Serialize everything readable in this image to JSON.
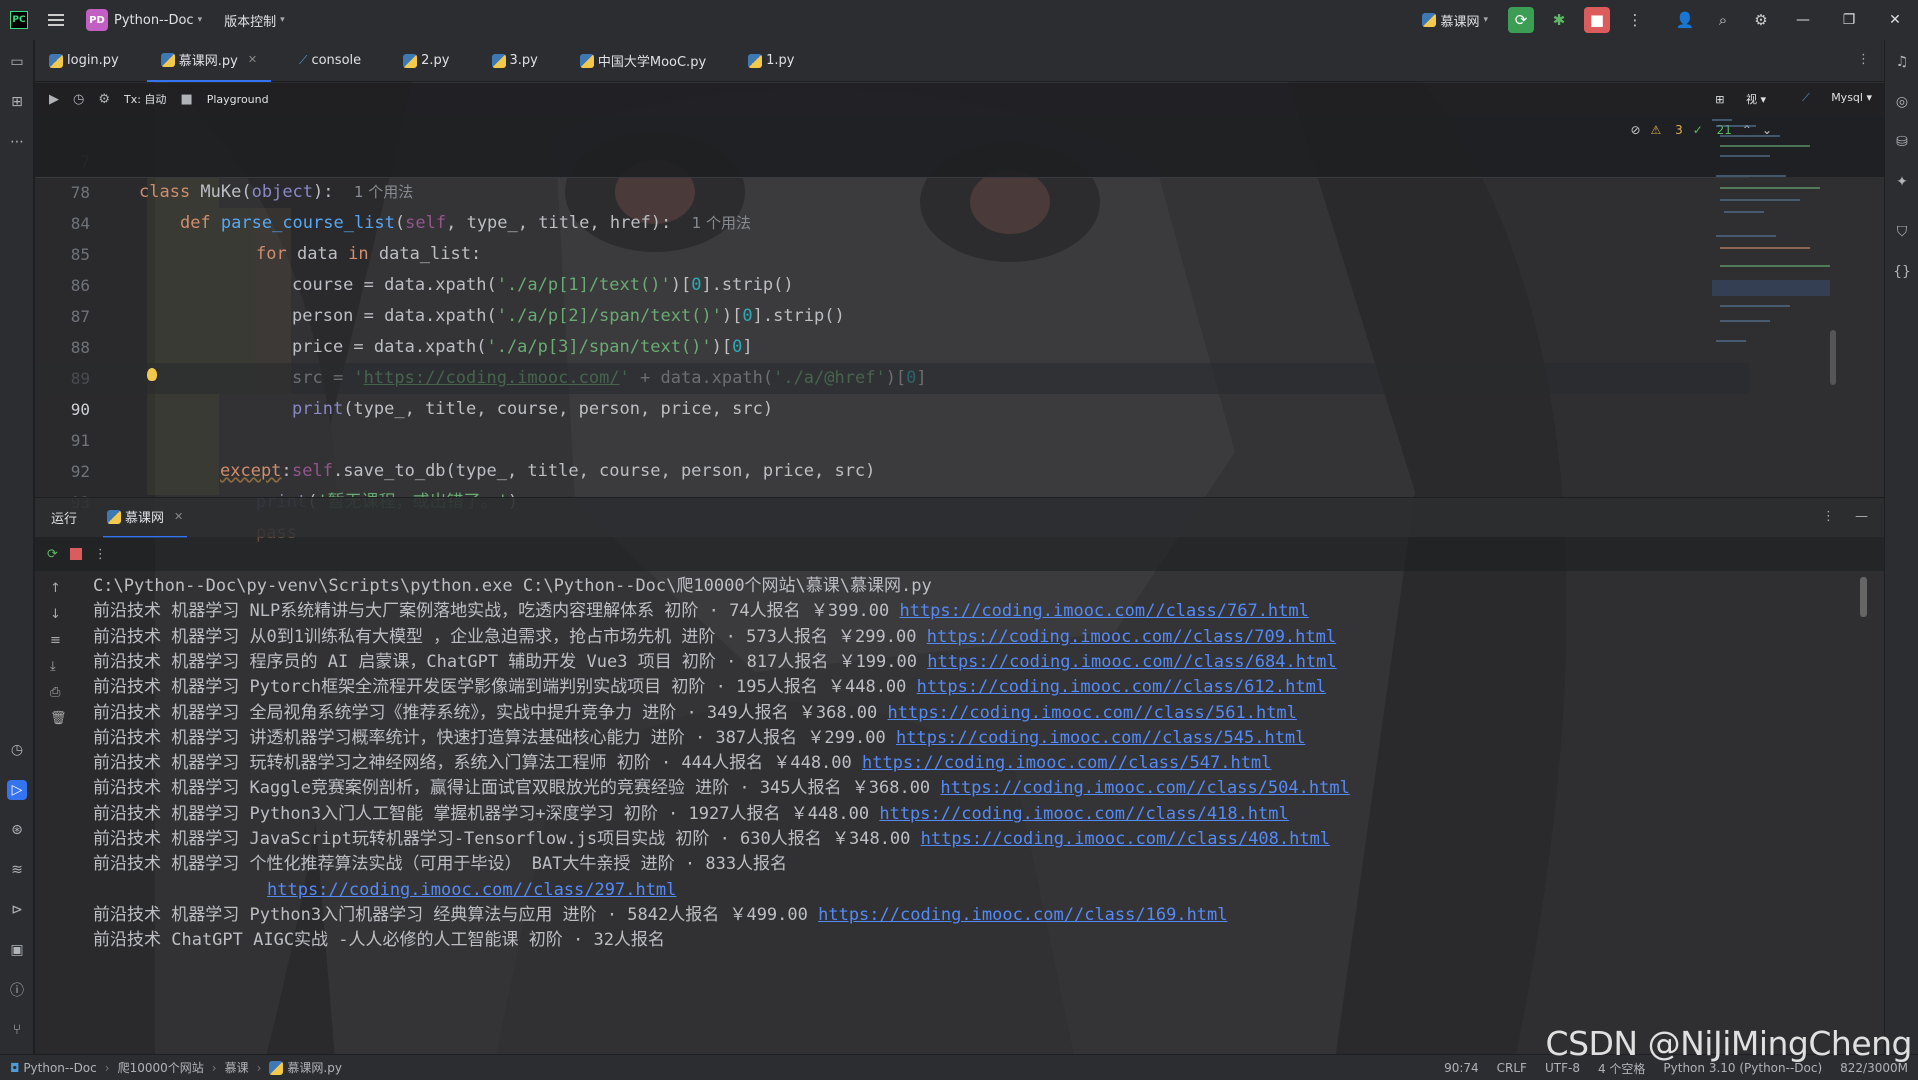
{
  "titlebar": {
    "project_badge": "PD",
    "project_name": "Python--Doc",
    "vcs_label": "版本控制",
    "run_config": "慕课网"
  },
  "tabs": [
    {
      "label": "login.py"
    },
    {
      "label": "慕课网.py"
    },
    {
      "label": "console"
    },
    {
      "label": "2.py"
    },
    {
      "label": "3.py"
    },
    {
      "label": "中国大学MooC.py"
    },
    {
      "label": "1.py"
    }
  ],
  "editor_toolbar": {
    "tx_label": "Tx: 自动",
    "playground_label": "Playground",
    "db_label": "Mysql",
    "view_label": "视"
  },
  "editor": {
    "sticky": [
      {
        "num": "7",
        "code": "class MuKe(object):",
        "hint": "1 个用法"
      },
      {
        "num": "78",
        "code": "    def parse_course_list(self, type_, title, href):",
        "hint": "1 个用法"
      }
    ],
    "inspections": {
      "warnings": "3",
      "checks": "21"
    },
    "lines": [
      {
        "num": "84",
        "code": "for data in data_list:"
      },
      {
        "num": "85",
        "code": "course = data.xpath('./a/p[1]/text()')[0].strip()"
      },
      {
        "num": "86",
        "code": "person = data.xpath('./a/p[2]/span/text()')[0].strip()"
      },
      {
        "num": "87",
        "code": "price = data.xpath('./a/p[3]/span/text()')[0]"
      },
      {
        "num": "88",
        "code": "src = 'https://coding.imooc.com/' + data.xpath('./a/@href')[0]"
      },
      {
        "num": "89",
        "code": "print(type_, title, course, person, price, src)"
      },
      {
        "num": "90",
        "code": "self.save_to_db(type_, title, course, person, price, src)"
      },
      {
        "num": "91",
        "code": "except:"
      },
      {
        "num": "92",
        "code": "print('暂无课程，或出错了。')"
      },
      {
        "num": "93",
        "code": "pass"
      }
    ]
  },
  "run_panel": {
    "title": "运行",
    "tab_label": "慕课网",
    "command": "C:\\Python--Doc\\py-venv\\Scripts\\python.exe C:\\Python--Doc\\爬10000个网站\\慕课\\慕课网.py",
    "rows": [
      {
        "text": "前沿技术 机器学习 NLP系统精讲与大厂案例落地实战，吃透内容理解体系 初阶 · 74人报名 ￥399.00 ",
        "link": "https://coding.imooc.com//class/767.html"
      },
      {
        "text": "前沿技术 机器学习 从0到1训练私有大模型 ，企业急迫需求，抢占市场先机 进阶 · 573人报名 ￥299.00 ",
        "link": "https://coding.imooc.com//class/709.html"
      },
      {
        "text": "前沿技术 机器学习 程序员的 AI 启蒙课，ChatGPT 辅助开发 Vue3 项目 初阶 · 817人报名 ￥199.00 ",
        "link": "https://coding.imooc.com//class/684.html"
      },
      {
        "text": "前沿技术 机器学习 Pytorch框架全流程开发医学影像端到端判别实战项目 初阶 · 195人报名 ￥448.00 ",
        "link": "https://coding.imooc.com//class/612.html"
      },
      {
        "text": "前沿技术 机器学习 全局视角系统学习《推荐系统》，实战中提升竞争力 进阶 · 349人报名 ￥368.00 ",
        "link": "https://coding.imooc.com//class/561.html"
      },
      {
        "text": "前沿技术 机器学习 讲透机器学习概率统计，快速打造算法基础核心能力 进阶 · 387人报名 ￥299.00 ",
        "link": "https://coding.imooc.com//class/545.html"
      },
      {
        "text": "前沿技术 机器学习 玩转机器学习之神经网络，系统入门算法工程师 初阶 · 444人报名 ￥448.00 ",
        "link": "https://coding.imooc.com//class/547.html"
      },
      {
        "text": "前沿技术 机器学习 Kaggle竞赛案例剖析，赢得让面试官双眼放光的竞赛经验 进阶 · 345人报名 ￥368.00 ",
        "link": "https://coding.imooc.com//class/504.html"
      },
      {
        "text": "前沿技术 机器学习 Python3入门人工智能 掌握机器学习+深度学习 初阶 · 1927人报名 ￥448.00 ",
        "link": "https://coding.imooc.com//class/418.html"
      },
      {
        "text": "前沿技术 机器学习 JavaScript玩转机器学习-Tensorflow.js项目实战 初阶 · 630人报名 ￥348.00 ",
        "link": "https://coding.imooc.com//class/408.html"
      },
      {
        "text": "前沿技术 机器学习 个性化推荐算法实战（可用于毕设） BAT大牛亲授 进阶 · 833人报名",
        "link": ""
      },
      {
        "text": "                 ",
        "link": "https://coding.imooc.com//class/297.html"
      },
      {
        "text": "前沿技术 机器学习 Python3入门机器学习 经典算法与应用 进阶 · 5842人报名 ￥499.00 ",
        "link": "https://coding.imooc.com//class/169.html"
      },
      {
        "text": "前沿技术 ChatGPT AIGC实战 -人人必修的人工智能课 初阶 · 32人报名",
        "link": ""
      }
    ]
  },
  "statusbar": {
    "crumbs": [
      "Python--Doc",
      "爬10000个网站",
      "慕课",
      "慕课网.py"
    ],
    "position": "90:74",
    "line_sep": "CRLF",
    "encoding": "UTF-8",
    "indent": "4 个空格",
    "interpreter": "Python 3.10 (Python--Doc)",
    "memory": "822/3000M"
  },
  "watermark": "CSDN @NiJiMingCheng",
  "colors": {
    "accent": "#3574f0",
    "run_green": "#3c9e54",
    "stop_red": "#db5c5c",
    "link": "#548af7"
  }
}
